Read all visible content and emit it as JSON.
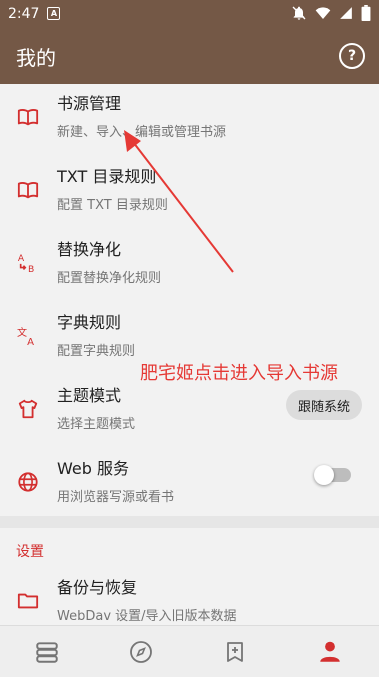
{
  "status_bar": {
    "time": "2:47",
    "notification_icon": "A"
  },
  "app_bar": {
    "title": "我的",
    "help_icon_label": "?"
  },
  "items": [
    {
      "title": "书源管理",
      "subtitle": "新建、导入、编辑或管理书源",
      "icon": "book-open-icon"
    },
    {
      "title": "TXT 目录规则",
      "subtitle": "配置 TXT 目录规则",
      "icon": "book-open-icon"
    },
    {
      "title": "替换净化",
      "subtitle": "配置替换净化规则",
      "icon": "replace-icon"
    },
    {
      "title": "字典规则",
      "subtitle": "配置字典规则",
      "icon": "translate-icon"
    },
    {
      "title": "主题模式",
      "subtitle": "选择主题模式",
      "icon": "shirt-icon"
    },
    {
      "title": "Web 服务",
      "subtitle": "用浏览器写源或看书",
      "icon": "globe-icon"
    }
  ],
  "theme_chip_label": "跟随系统",
  "web_service_enabled": false,
  "settings_section_label": "设置",
  "backup_item": {
    "title": "备份与恢复",
    "subtitle": "WebDav 设置/导入旧版本数据",
    "icon": "folder-icon"
  },
  "annotation_text": "肥宅姬点击进入导入书源",
  "colors": {
    "primary": "#745846",
    "accent": "#d32f2f",
    "annotation": "#e53935"
  },
  "bottom_nav": [
    {
      "icon": "bookshelf-icon",
      "active": false
    },
    {
      "icon": "compass-icon",
      "active": false
    },
    {
      "icon": "bookmark-add-icon",
      "active": false
    },
    {
      "icon": "person-icon",
      "active": true
    }
  ]
}
